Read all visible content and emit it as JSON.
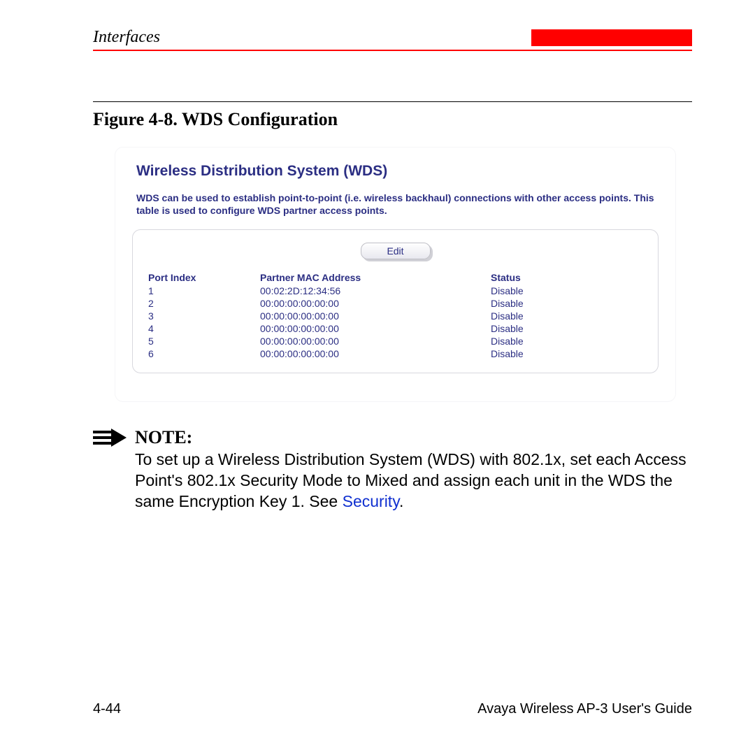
{
  "header": {
    "section": "Interfaces"
  },
  "figure": {
    "caption": "Figure 4-8.    WDS Configuration"
  },
  "wds": {
    "title": "Wireless Distribution System (WDS)",
    "desc": "WDS can be used to establish point-to-point (i.e. wireless backhaul) connections with other access points. This table is used to configure WDS partner access points.",
    "edit_label": "Edit",
    "columns": {
      "port": "Port Index",
      "mac": "Partner MAC Address",
      "status": "Status"
    },
    "rows": [
      {
        "port": "1",
        "mac": "00:02:2D:12:34:56",
        "status": "Disable"
      },
      {
        "port": "2",
        "mac": "00:00:00:00:00:00",
        "status": "Disable"
      },
      {
        "port": "3",
        "mac": "00:00:00:00:00:00",
        "status": "Disable"
      },
      {
        "port": "4",
        "mac": "00:00:00:00:00:00",
        "status": "Disable"
      },
      {
        "port": "5",
        "mac": "00:00:00:00:00:00",
        "status": "Disable"
      },
      {
        "port": "6",
        "mac": "00:00:00:00:00:00",
        "status": "Disable"
      }
    ]
  },
  "note": {
    "label": "NOTE:",
    "body_pre": "To set up a Wireless Distribution System (WDS) with 802.1x, set each Access Point's 802.1x Security Mode to Mixed and assign each unit in the WDS the same Encryption Key 1. See ",
    "link": "Security",
    "body_post": "."
  },
  "footer": {
    "page": "4-44",
    "guide": "Avaya Wireless AP-3 User's Guide"
  }
}
